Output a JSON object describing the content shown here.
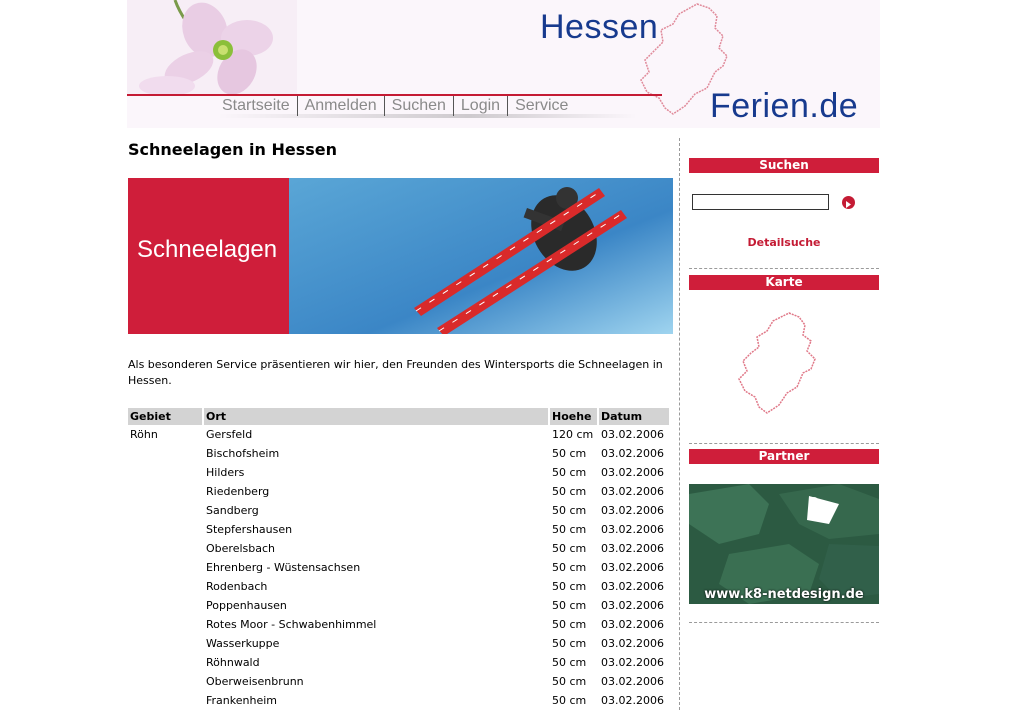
{
  "header": {
    "logo_line1": "Hessen",
    "logo_line2": "Ferien.de",
    "nav": [
      "Startseite",
      "Anmelden",
      "Suchen",
      "Login",
      "Service"
    ]
  },
  "main": {
    "title": "Schneelagen in Hessen",
    "banner_label": "Schneelagen",
    "intro": "Als besonderen Service präsentieren wir hier, den Freunden des Wintersports die Schneelagen in Hessen.",
    "table": {
      "headers": [
        "Gebiet",
        "Ort",
        "Hoehe",
        "Datum"
      ],
      "rows": [
        [
          "Röhn",
          "Gersfeld",
          "120 cm",
          "03.02.2006"
        ],
        [
          "",
          "Bischofsheim",
          "50 cm",
          "03.02.2006"
        ],
        [
          "",
          "Hilders",
          "50 cm",
          "03.02.2006"
        ],
        [
          "",
          "Riedenberg",
          "50 cm",
          "03.02.2006"
        ],
        [
          "",
          "Sandberg",
          "50 cm",
          "03.02.2006"
        ],
        [
          "",
          "Stepfershausen",
          "50 cm",
          "03.02.2006"
        ],
        [
          "",
          "Oberelsbach",
          "50 cm",
          "03.02.2006"
        ],
        [
          "",
          "Ehrenberg - Wüstensachsen",
          "50 cm",
          "03.02.2006"
        ],
        [
          "",
          "Rodenbach",
          "50 cm",
          "03.02.2006"
        ],
        [
          "",
          "Poppenhausen",
          "50 cm",
          "03.02.2006"
        ],
        [
          "",
          "Rotes Moor - Schwabenhimmel",
          "50 cm",
          "03.02.2006"
        ],
        [
          "",
          "Wasserkuppe",
          "50 cm",
          "03.02.2006"
        ],
        [
          "",
          "Röhnwald",
          "50 cm",
          "03.02.2006"
        ],
        [
          "",
          "Oberweisenbrunn",
          "50 cm",
          "03.02.2006"
        ],
        [
          "",
          "Frankenheim",
          "50 cm",
          "03.02.2006"
        ]
      ]
    }
  },
  "sidebar": {
    "search_heading": "Suchen",
    "search_value": "",
    "detail_link": "Detailsuche",
    "map_heading": "Karte",
    "partner_heading": "Partner",
    "partner_text": "www.k8-netdesign.de"
  },
  "colors": {
    "accent_red": "#cf1e3a",
    "logo_blue": "#173a8e",
    "nav_gray": "#8a8a8a"
  }
}
